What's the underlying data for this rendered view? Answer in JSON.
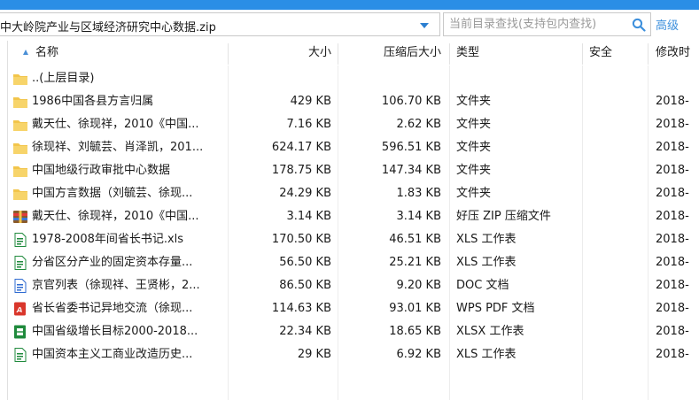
{
  "address": {
    "path": "中大岭院产业与区域经济研究中心数据.zip"
  },
  "search": {
    "placeholder": "当前目录查找(支持包内查找)",
    "advanced_label": "高级"
  },
  "columns": {
    "name": "名称",
    "size": "大小",
    "compressed": "压缩后大小",
    "type": "类型",
    "security": "安全",
    "modified": "修改时"
  },
  "colors": {
    "accent": "#2a8ee6",
    "folder": "#f2c54b",
    "xls": "#1f8a3c",
    "doc": "#2f6bd1",
    "pdf": "#d9362b",
    "zip": "#8a5a2b"
  },
  "files": [
    {
      "icon": "folder-icon",
      "name": "..(上层目录)",
      "size": "",
      "compressed": "",
      "type": "",
      "date": ""
    },
    {
      "icon": "folder-icon",
      "name": "1986中国各县方言归属",
      "size": "429 KB",
      "compressed": "106.70 KB",
      "type": "文件夹",
      "date": "2018-"
    },
    {
      "icon": "folder-icon",
      "name": "戴天仕、徐现祥，2010《中国...",
      "size": "7.16 KB",
      "compressed": "2.62 KB",
      "type": "文件夹",
      "date": "2018-"
    },
    {
      "icon": "folder-icon",
      "name": "徐现祥、刘毓芸、肖泽凯，201...",
      "size": "624.17 KB",
      "compressed": "596.51 KB",
      "type": "文件夹",
      "date": "2018-"
    },
    {
      "icon": "folder-icon",
      "name": "中国地级行政审批中心数据",
      "size": "178.75 KB",
      "compressed": "147.34 KB",
      "type": "文件夹",
      "date": "2018-"
    },
    {
      "icon": "folder-icon",
      "name": "中国方言数据（刘毓芸、徐现...",
      "size": "24.29 KB",
      "compressed": "1.83 KB",
      "type": "文件夹",
      "date": "2018-"
    },
    {
      "icon": "zip-archive-icon",
      "name": "戴天仕、徐现祥，2010《中国...",
      "size": "3.14 KB",
      "compressed": "3.14 KB",
      "type": "好压 ZIP 压缩文件",
      "date": "2018-"
    },
    {
      "icon": "xls-file-icon",
      "name": "1978-2008年间省长书记.xls",
      "size": "170.50 KB",
      "compressed": "46.51 KB",
      "type": "XLS 工作表",
      "date": "2018-"
    },
    {
      "icon": "xls-file-icon",
      "name": "分省区分产业的固定资本存量...",
      "size": "56.50 KB",
      "compressed": "25.21 KB",
      "type": "XLS 工作表",
      "date": "2018-"
    },
    {
      "icon": "doc-file-icon",
      "name": "京官列表（徐现祥、王贤彬，2...",
      "size": "86.50 KB",
      "compressed": "9.20 KB",
      "type": "DOC 文档",
      "date": "2018-"
    },
    {
      "icon": "pdf-file-icon",
      "name": "省长省委书记异地交流（徐现...",
      "size": "114.63 KB",
      "compressed": "93.01 KB",
      "type": "WPS PDF 文档",
      "date": "2018-"
    },
    {
      "icon": "xlsx-file-icon",
      "name": "中国省级增长目标2000-2018...",
      "size": "22.34 KB",
      "compressed": "18.65 KB",
      "type": "XLSX 工作表",
      "date": "2018-"
    },
    {
      "icon": "xls-file-icon",
      "name": "中国资本主义工商业改造历史...",
      "size": "29 KB",
      "compressed": "6.92 KB",
      "type": "XLS 工作表",
      "date": "2018-"
    }
  ]
}
